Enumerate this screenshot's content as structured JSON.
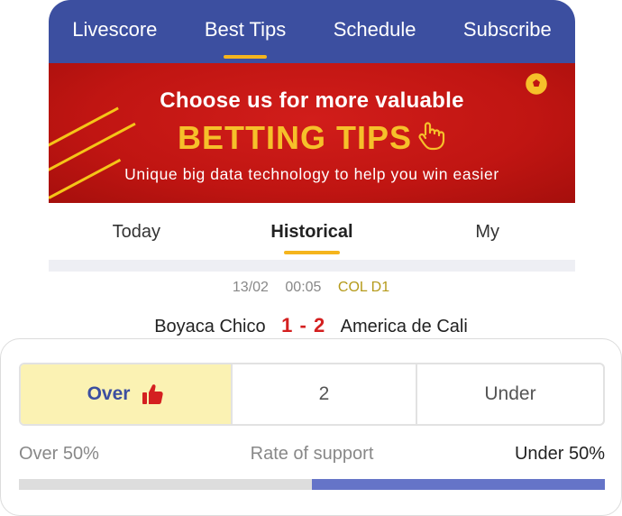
{
  "nav": {
    "items": [
      {
        "label": "Livescore"
      },
      {
        "label": "Best Tips"
      },
      {
        "label": "Schedule"
      },
      {
        "label": "Subscribe"
      }
    ],
    "active": "Best Tips"
  },
  "banner": {
    "headline": "Choose us for more valuable",
    "title": "BETTING TIPS",
    "tagline": "Unique big data technology to help you win easier"
  },
  "subtabs": {
    "items": [
      {
        "label": "Today"
      },
      {
        "label": "Historical"
      },
      {
        "label": "My"
      }
    ],
    "active": "Historical"
  },
  "match": {
    "date": "13/02",
    "time": "00:05",
    "league": "COL D1",
    "home": "Boyaca Chico",
    "score": "1 - 2",
    "away": "America de Cali"
  },
  "tip": {
    "over_label": "Over",
    "line_value": "2",
    "under_label": "Under",
    "selected": "Over",
    "over_support_label": "Over 50%",
    "rate_label": "Rate of support",
    "under_support_label": "Under 50%",
    "over_support_fraction": 0.5,
    "under_support_fraction": 0.5
  },
  "colors": {
    "nav_bg": "#3c4fa0",
    "accent_yellow": "#f5b51d",
    "banner_red": "#c01512",
    "score_red": "#d42020",
    "selected_bg": "#fbf2b3",
    "under_bar": "#6574c8"
  },
  "icons": {
    "banner_hand": "pointing-hand-icon",
    "banner_ball": "soccer-ball-icon",
    "over_thumb": "thumbs-up-icon"
  }
}
